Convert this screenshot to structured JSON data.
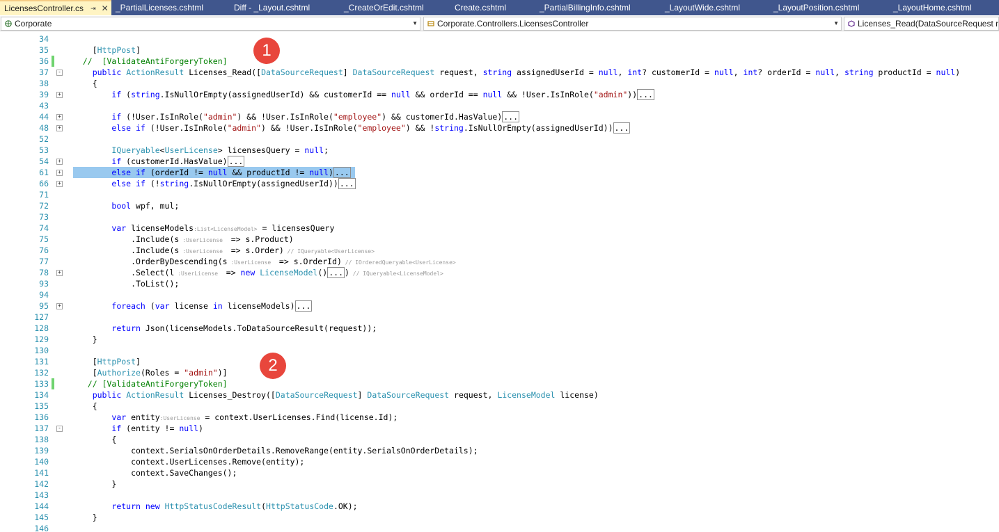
{
  "tabs": [
    {
      "label": "LicensesController.cs",
      "active": true
    },
    {
      "label": "_PartialLicenses.cshtml"
    },
    {
      "label": "Diff - _Layout.cshtml"
    },
    {
      "label": "_CreateOrEdit.cshtml"
    },
    {
      "label": "Create.cshtml"
    },
    {
      "label": "_PartialBillingInfo.cshtml"
    },
    {
      "label": "_LayoutWide.cshtml"
    },
    {
      "label": "_LayoutPosition.cshtml"
    },
    {
      "label": "_LayoutHome.cshtml"
    }
  ],
  "navbar": {
    "project": "Corporate",
    "type": "Corporate.Controllers.LicensesController",
    "member": "Licenses_Read(DataSourceRequest req"
  },
  "badges": [
    "1",
    "2"
  ],
  "code_lines": [
    {
      "n": "34",
      "html": ""
    },
    {
      "n": "35",
      "html": "    [<span class='ty'>HttpPost</span>]"
    },
    {
      "n": "36",
      "html": "  <span class='cm'>//  [ValidateAntiForgeryToken]</span>"
    },
    {
      "n": "37",
      "html": "    <span class='kw'>public</span> <span class='ty'>ActionResult</span> Licenses_Read([<span class='ty'>DataSourceRequest</span>] <span class='ty'>DataSourceRequest</span> request, <span class='kw'>string</span> assignedUserId = <span class='kw'>null</span>, <span class='kw'>int</span>? customerId = <span class='kw'>null</span>, <span class='kw'>int</span>? orderId = <span class='kw'>null</span>, <span class='kw'>string</span> productId = <span class='kw'>null</span>)"
    },
    {
      "n": "38",
      "html": "    {"
    },
    {
      "n": "39",
      "html": "        <span class='kw'>if</span> (<span class='kw'>string</span>.IsNullOrEmpty(assignedUserId) &amp;&amp; customerId == <span class='kw'>null</span> &amp;&amp; orderId == <span class='kw'>null</span> &amp;&amp; !User.IsInRole(<span class='st'>\"admin\"</span>))..."
    },
    {
      "n": "43",
      "html": ""
    },
    {
      "n": "44",
      "html": "        <span class='kw'>if</span> (!User.IsInRole(<span class='st'>\"admin\"</span>) &amp;&amp; !User.IsInRole(<span class='st'>\"employee\"</span>) &amp;&amp; customerId.HasValue)..."
    },
    {
      "n": "48",
      "html": "        <span class='kw'>else if</span> (!User.IsInRole(<span class='st'>\"admin\"</span>) &amp;&amp; !User.IsInRole(<span class='st'>\"employee\"</span>) &amp;&amp; !<span class='kw'>string</span>.IsNullOrEmpty(assignedUserId))..."
    },
    {
      "n": "52",
      "html": ""
    },
    {
      "n": "53",
      "html": "        <span class='ty'>IQueryable</span>&lt;<span class='ty'>UserLicense</span>&gt; licensesQuery = <span class='kw'>null</span>;"
    },
    {
      "n": "54",
      "html": "        <span class='kw'>if</span> (customerId.HasValue)..."
    },
    {
      "n": "61",
      "html": "        <span class='kw'>else if</span> (orderId != <span class='kw'>null</span> &amp;&amp; productId != <span class='kw'>null</span>)..."
    },
    {
      "n": "66",
      "html": "        <span class='kw'>else if</span> (!<span class='kw'>string</span>.IsNullOrEmpty(assignedUserId))..."
    },
    {
      "n": "71",
      "html": ""
    },
    {
      "n": "72",
      "html": "        <span class='kw'>bool</span> wpf, mul;"
    },
    {
      "n": "73",
      "html": ""
    },
    {
      "n": "74",
      "html": "        <span class='kw'>var</span> licenseModels<span class='hint'>:List&lt;LicenseModel&gt;</span> = licensesQuery"
    },
    {
      "n": "75",
      "html": "            .Include(s<span class='hint'> :UserLicense </span> =&gt; s.Product)"
    },
    {
      "n": "76",
      "html": "            .Include(s<span class='hint'> :UserLicense </span> =&gt; s.Order)<span class='hint'> // IQueryable&lt;UserLicense&gt;</span>"
    },
    {
      "n": "77",
      "html": "            .OrderByDescending(s<span class='hint'> :UserLicense </span> =&gt; s.OrderId)<span class='hint'> // IOrderedQueryable&lt;UserLicense&gt;</span>"
    },
    {
      "n": "78",
      "html": "            .Select(l<span class='hint'> :UserLicense </span> =&gt; <span class='kw'>new</span> <span class='ty'>LicenseModel</span>()...)<span class='hint'> // IQueryable&lt;LicenseModel&gt;</span>"
    },
    {
      "n": "93",
      "html": "            .ToList();"
    },
    {
      "n": "94",
      "html": ""
    },
    {
      "n": "95",
      "html": "        <span class='kw'>foreach</span> (<span class='kw'>var</span> license <span class='kw'>in</span> licenseModels)..."
    },
    {
      "n": "127",
      "html": ""
    },
    {
      "n": "128",
      "html": "        <span class='kw'>return</span> Json(licenseModels.ToDataSourceResult(request));"
    },
    {
      "n": "129",
      "html": "    }"
    },
    {
      "n": "130",
      "html": ""
    },
    {
      "n": "131",
      "html": "    [<span class='ty'>HttpPost</span>]"
    },
    {
      "n": "132",
      "html": "    [<span class='ty'>Authorize</span>(Roles = <span class='st'>\"admin\"</span>)]"
    },
    {
      "n": "133",
      "html": "   <span class='cm'>// [ValidateAntiForgeryToken]</span>"
    },
    {
      "n": "134",
      "html": "    <span class='kw'>public</span> <span class='ty'>ActionResult</span> Licenses_Destroy([<span class='ty'>DataSourceRequest</span>] <span class='ty'>DataSourceRequest</span> request, <span class='ty'>LicenseModel</span> license)"
    },
    {
      "n": "135",
      "html": "    {"
    },
    {
      "n": "136",
      "html": "        <span class='kw'>var</span> entity<span class='hint'>:UserLicense</span> = context.UserLicenses.Find(license.Id);"
    },
    {
      "n": "137",
      "html": "        <span class='kw'>if</span> (entity != <span class='kw'>null</span>)"
    },
    {
      "n": "138",
      "html": "        {"
    },
    {
      "n": "139",
      "html": "            context.SerialsOnOrderDetails.RemoveRange(entity.SerialsOnOrderDetails);"
    },
    {
      "n": "140",
      "html": "            context.UserLicenses.Remove(entity);"
    },
    {
      "n": "141",
      "html": "            context.SaveChanges();"
    },
    {
      "n": "142",
      "html": "        }"
    },
    {
      "n": "143",
      "html": ""
    },
    {
      "n": "144",
      "html": "        <span class='kw'>return</span> <span class='kw'>new</span> <span class='ty'>HttpStatusCodeResult</span>(<span class='ty'>HttpStatusCode</span>.OK);"
    },
    {
      "n": "145",
      "html": "    }"
    },
    {
      "n": "146",
      "html": ""
    }
  ]
}
